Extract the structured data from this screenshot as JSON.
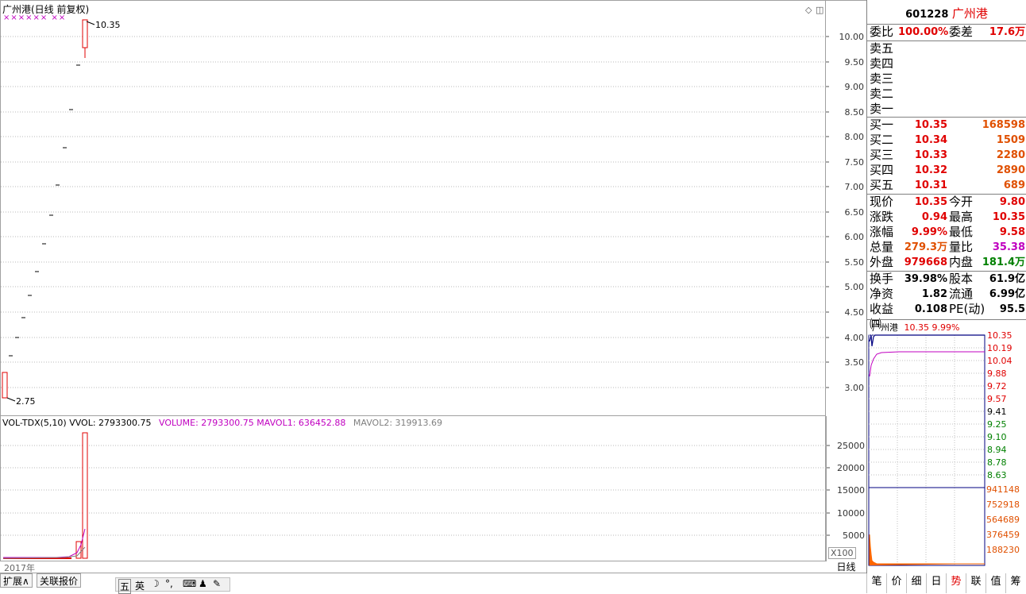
{
  "main_chart": {
    "title": "广州港(日线 前复权)",
    "marks": "×××××× ××",
    "high_label": "10.35",
    "low_label": "2.75",
    "y_ticks": [
      "10.00",
      "9.50",
      "9.00",
      "8.50",
      "8.00",
      "7.50",
      "7.00",
      "6.50",
      "6.00",
      "5.50",
      "5.00",
      "4.50",
      "4.00",
      "3.50",
      "3.00"
    ]
  },
  "vol_chart": {
    "indicator": "VOL-TDX(5,10)",
    "vvol": "VVOL: 2793300.75",
    "volume": "VOLUME: 2793300.75",
    "mavol1": "MAVOL1: 636452.88",
    "mavol2": "MAVOL2: 319913.69",
    "y_ticks": [
      "25000",
      "20000",
      "15000",
      "10000",
      "5000"
    ],
    "unit": "X100",
    "year": "2017年"
  },
  "quote": {
    "code": "601228",
    "name": "广州港",
    "weibi_label": "委比",
    "weibi": "100.00%",
    "weicha_label": "委差",
    "weicha": "17.6万",
    "sell": [
      {
        "label": "卖五",
        "price": "",
        "vol": ""
      },
      {
        "label": "卖四",
        "price": "",
        "vol": ""
      },
      {
        "label": "卖三",
        "price": "",
        "vol": ""
      },
      {
        "label": "卖二",
        "price": "",
        "vol": ""
      },
      {
        "label": "卖一",
        "price": "",
        "vol": ""
      }
    ],
    "buy": [
      {
        "label": "买一",
        "price": "10.35",
        "vol": "168598"
      },
      {
        "label": "买二",
        "price": "10.34",
        "vol": "1509"
      },
      {
        "label": "买三",
        "price": "10.33",
        "vol": "2280"
      },
      {
        "label": "买四",
        "price": "10.32",
        "vol": "2890"
      },
      {
        "label": "买五",
        "price": "10.31",
        "vol": "689"
      }
    ],
    "stats": [
      {
        "l1": "现价",
        "v1": "10.35",
        "c1": "red",
        "l2": "今开",
        "v2": "9.80",
        "c2": "red"
      },
      {
        "l1": "涨跌",
        "v1": "0.94",
        "c1": "red",
        "l2": "最高",
        "v2": "10.35",
        "c2": "red"
      },
      {
        "l1": "涨幅",
        "v1": "9.99%",
        "c1": "red",
        "l2": "最低",
        "v2": "9.58",
        "c2": "red"
      },
      {
        "l1": "总量",
        "v1": "279.3万",
        "c1": "org",
        "l2": "量比",
        "v2": "35.38",
        "c2": "mag"
      },
      {
        "l1": "外盘",
        "v1": "979668",
        "c1": "red",
        "l2": "内盘",
        "v2": "181.4万",
        "c2": "grn"
      }
    ],
    "fund": [
      {
        "l1": "换手",
        "v1": "39.98%",
        "l2": "股本",
        "v2": "61.9亿"
      },
      {
        "l1": "净资",
        "v1": "1.82",
        "l2": "流通",
        "v2": "6.99亿"
      },
      {
        "l1": "收益㈣",
        "v1": "0.108",
        "l2": "PE(动)",
        "v2": "95.5"
      }
    ]
  },
  "mini_chart": {
    "name": "广州港",
    "price": "10.35",
    "pct": "9.99%",
    "price_ticks": [
      {
        "v": "10.35",
        "c": "#e00000"
      },
      {
        "v": "10.19",
        "c": "#e00000"
      },
      {
        "v": "10.04",
        "c": "#e00000"
      },
      {
        "v": "9.88",
        "c": "#e00000"
      },
      {
        "v": "9.72",
        "c": "#e00000"
      },
      {
        "v": "9.57",
        "c": "#e00000"
      },
      {
        "v": "9.41",
        "c": "#000000"
      },
      {
        "v": "9.25",
        "c": "#008000"
      },
      {
        "v": "9.10",
        "c": "#008000"
      },
      {
        "v": "8.94",
        "c": "#008000"
      },
      {
        "v": "8.78",
        "c": "#008000"
      },
      {
        "v": "8.63",
        "c": "#008000"
      }
    ],
    "vol_ticks": [
      "941148",
      "752918",
      "564689",
      "376459",
      "188230"
    ]
  },
  "bottom": {
    "tab_expand": "扩展∧",
    "tab_related": "关联报价",
    "period": "日线",
    "ime": [
      "五",
      "英"
    ]
  },
  "right_tabs": [
    "笔",
    "价",
    "细",
    "日",
    "势",
    "联",
    "值",
    "筹"
  ],
  "colors": {
    "up": "#e00000",
    "down": "#008000",
    "grid": "#b0b0b0",
    "accent": "#c000c0"
  }
}
